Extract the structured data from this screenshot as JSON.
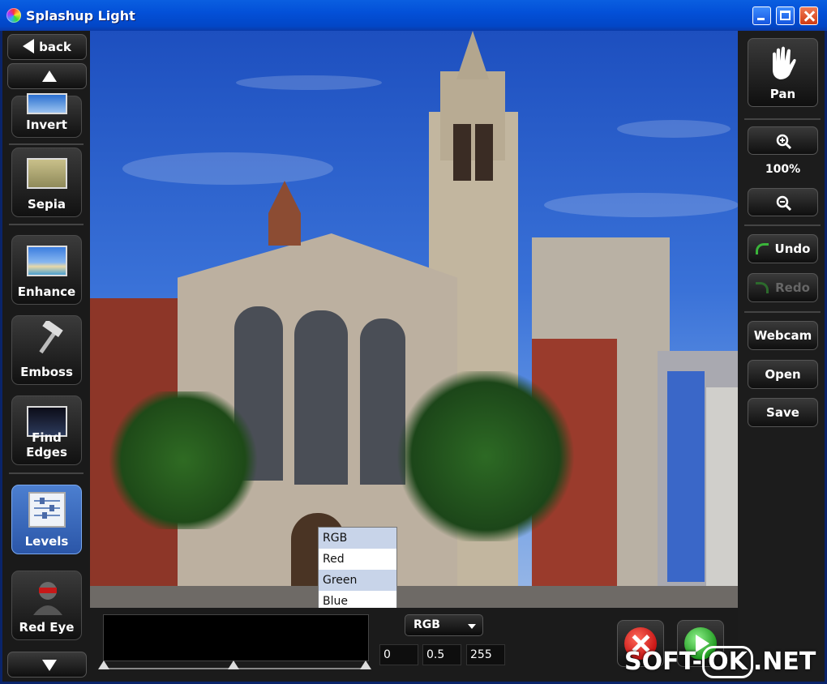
{
  "window": {
    "title": "Splashup Light",
    "app_icon": "splashup-icon"
  },
  "left_panel": {
    "back_label": "back",
    "tools": [
      {
        "label": "Invert",
        "icon": "invert-thumb-icon"
      },
      {
        "label": "Sepia",
        "icon": "sepia-thumb-icon"
      },
      {
        "label": "Enhance",
        "icon": "enhance-thumb-icon"
      },
      {
        "label": "Emboss",
        "icon": "hammer-icon"
      },
      {
        "label": "Find Edges",
        "icon": "find-edges-thumb-icon"
      },
      {
        "label": "Levels",
        "icon": "levels-sliders-icon",
        "active": true
      },
      {
        "label": "Red Eye",
        "icon": "red-eye-person-icon"
      }
    ]
  },
  "right_panel": {
    "pan_label": "Pan",
    "zoom_level": "100%",
    "undo_label": "Undo",
    "redo_label": "Redo",
    "webcam_label": "Webcam",
    "open_label": "Open",
    "save_label": "Save"
  },
  "levels": {
    "channel_selected": "RGB",
    "channel_options": [
      "RGB",
      "Red",
      "Green",
      "Blue"
    ],
    "input_black": "0",
    "input_gamma": "0.5",
    "input_white": "255"
  },
  "watermark": {
    "left": "SOFT-",
    "boxed": "OK",
    "right": ".NET"
  },
  "colors": {
    "titlebar": "#0350d8",
    "active_tool": "#4c7fd0",
    "cancel": "#d41818",
    "apply": "#2fb52f"
  }
}
